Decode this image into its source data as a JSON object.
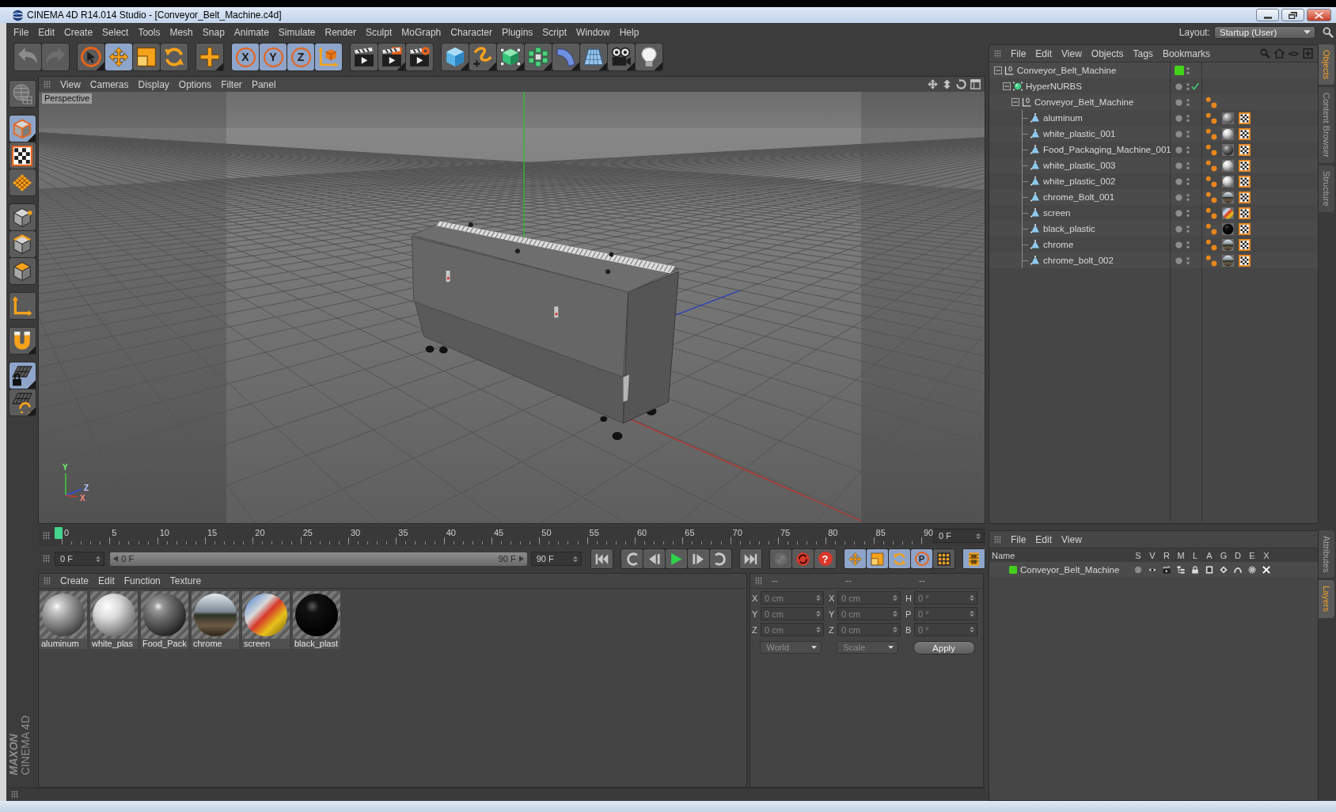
{
  "window": {
    "title": "CINEMA 4D R14.014 Studio - [Conveyor_Belt_Machine.c4d]"
  },
  "menu_bar": [
    "File",
    "Edit",
    "Create",
    "Select",
    "Tools",
    "Mesh",
    "Snap",
    "Animate",
    "Simulate",
    "Render",
    "Sculpt",
    "MoGraph",
    "Character",
    "Plugins",
    "Script",
    "Window",
    "Help"
  ],
  "layout": {
    "label": "Layout:",
    "value": "Startup (User)"
  },
  "toolbar": [
    [
      {
        "kind": "undo",
        "selected": false,
        "disabled": false,
        "menu": false
      },
      {
        "kind": "redo",
        "selected": false,
        "disabled": true,
        "menu": false
      }
    ],
    [
      {
        "kind": "select",
        "selected": false,
        "menu": true
      },
      {
        "kind": "move",
        "selected": true,
        "menu": false
      },
      {
        "kind": "scale",
        "selected": false,
        "menu": false
      },
      {
        "kind": "rotate",
        "selected": false,
        "menu": false
      }
    ],
    [
      {
        "kind": "plus",
        "selected": false,
        "menu": true
      }
    ],
    [
      {
        "kind": "axis",
        "label": "X",
        "selected": true,
        "menu": false
      },
      {
        "kind": "axis",
        "label": "Y",
        "selected": true,
        "menu": false
      },
      {
        "kind": "axis",
        "label": "Z",
        "selected": true,
        "menu": false
      },
      {
        "kind": "coords",
        "selected": true,
        "menu": false
      }
    ],
    [
      {
        "kind": "render-view",
        "selected": false,
        "menu": false
      },
      {
        "kind": "render-picture",
        "selected": false,
        "menu": true
      },
      {
        "kind": "render-settings",
        "selected": false,
        "menu": false
      }
    ],
    [
      {
        "kind": "cube",
        "selected": false,
        "menu": true
      },
      {
        "kind": "spline",
        "selected": false,
        "menu": true
      },
      {
        "kind": "nurbs",
        "selected": false,
        "menu": true
      },
      {
        "kind": "array",
        "selected": false,
        "menu": true
      },
      {
        "kind": "deformer",
        "selected": false,
        "menu": true
      },
      {
        "kind": "floor",
        "selected": false,
        "menu": true
      },
      {
        "kind": "camera",
        "selected": false,
        "menu": true
      },
      {
        "kind": "light",
        "selected": false,
        "menu": true
      }
    ]
  ],
  "tools": [
    [
      {
        "kind": "solo",
        "selected": false,
        "menu": false
      }
    ],
    [
      {
        "kind": "model",
        "selected": true,
        "menu": true
      },
      {
        "kind": "texture",
        "selected": false,
        "menu": false
      },
      {
        "kind": "workplane",
        "selected": false,
        "menu": false
      }
    ],
    [
      {
        "kind": "points",
        "selected": false,
        "menu": false
      },
      {
        "kind": "edges",
        "selected": false,
        "menu": false
      },
      {
        "kind": "polygons",
        "selected": false,
        "menu": false
      }
    ],
    [
      {
        "kind": "axis-mode",
        "selected": false,
        "menu": false
      }
    ],
    [
      {
        "kind": "snap",
        "selected": false,
        "menu": true
      }
    ],
    [
      {
        "kind": "lock-grid",
        "selected": true,
        "menu": true
      },
      {
        "kind": "planar",
        "selected": false,
        "menu": true
      }
    ]
  ],
  "logo": {
    "brand": "MAXON",
    "product": "CINEMA 4D"
  },
  "viewport": {
    "menu": [
      "View",
      "Cameras",
      "Display",
      "Options",
      "Filter",
      "Panel"
    ],
    "label": "Perspective",
    "gizmo_labels": [
      "Y",
      "Z",
      "X"
    ]
  },
  "timeline": {
    "ticks": [
      "0",
      "5",
      "10",
      "15",
      "20",
      "25",
      "30",
      "35",
      "40",
      "45",
      "50",
      "55",
      "60",
      "65",
      "70",
      "75",
      "80",
      "85",
      "90"
    ],
    "level": 0,
    "current": "0 F"
  },
  "transport": {
    "start": "0 F",
    "range": {
      "from": "0 F",
      "to": "90 F",
      "level": 1
    },
    "end": "90 F",
    "groups": [
      [
        {
          "kind": "go-start",
          "selected": false
        }
      ],
      [
        {
          "kind": "prev-key",
          "selected": false
        },
        {
          "kind": "prev-frame",
          "selected": false
        },
        {
          "kind": "play",
          "selected": false
        },
        {
          "kind": "next-frame",
          "selected": false
        },
        {
          "kind": "next-key",
          "selected": false
        }
      ],
      [
        {
          "kind": "go-end",
          "selected": false
        }
      ],
      [
        {
          "kind": "record",
          "selected": false,
          "disabled": true
        },
        {
          "kind": "autokey",
          "selected": false,
          "disabled": false
        },
        {
          "kind": "label",
          "label": "?",
          "selected": false,
          "disabled": false
        }
      ],
      [
        {
          "kind": "key-move",
          "selected": true
        },
        {
          "kind": "key-scale",
          "selected": true
        },
        {
          "kind": "key-rotate",
          "selected": true
        },
        {
          "kind": "ring",
          "label": "P",
          "selected": true
        },
        {
          "kind": "key-dots",
          "selected": false
        }
      ],
      [
        {
          "kind": "timeline",
          "selected": true
        }
      ]
    ]
  },
  "materials": {
    "menu": [
      "Create",
      "Edit",
      "Function",
      "Texture"
    ],
    "items": [
      {
        "name": "aluminum",
        "kind": "grey"
      },
      {
        "name": "white_plas",
        "kind": "white"
      },
      {
        "name": "Food_Pack",
        "kind": "dark"
      },
      {
        "name": "chrome",
        "kind": "chrome"
      },
      {
        "name": "screen",
        "kind": "screen"
      },
      {
        "name": "black_plast",
        "kind": "black"
      }
    ]
  },
  "coordinates": {
    "headers": [
      "--",
      "--",
      "--"
    ],
    "fields_disabled": true,
    "rows": [
      [
        {
          "axis": "X",
          "value": "0 cm"
        },
        {
          "axis": "X",
          "value": "0 cm"
        },
        {
          "axis": "H",
          "value": "0 °"
        }
      ],
      [
        {
          "axis": "Y",
          "value": "0 cm"
        },
        {
          "axis": "Y",
          "value": "0 cm"
        },
        {
          "axis": "P",
          "value": "0 °"
        }
      ],
      [
        {
          "axis": "Z",
          "value": "0 cm"
        },
        {
          "axis": "Z",
          "value": "0 cm"
        },
        {
          "axis": "B",
          "value": "0 °"
        }
      ]
    ],
    "dropdowns": [
      {
        "value": "World",
        "disabled": true
      },
      {
        "value": "Scale",
        "disabled": true
      }
    ],
    "apply": "Apply"
  },
  "objects": {
    "menu": [
      "File",
      "Edit",
      "View",
      "Objects",
      "Tags",
      "Bookmarks"
    ],
    "tree": [
      {
        "name": "Conveyor_Belt_Machine",
        "kind": "null",
        "color": "#44d11c",
        "expanded": true,
        "children": [
          {
            "name": "HyperNURBS",
            "kind": "hypernurbs",
            "enabled": true,
            "expanded": true,
            "children": [
              {
                "name": "Conveyor_Belt_Machine",
                "kind": "null",
                "expanded": true,
                "tags": [
                  {
                    "kind": "phong"
                  }
                ],
                "children": [
                  {
                    "name": "aluminum",
                    "kind": "polygon",
                    "tags": [
                      {
                        "kind": "phong"
                      },
                      {
                        "kind": "material-grey"
                      },
                      {
                        "kind": "uvw"
                      }
                    ]
                  },
                  {
                    "name": "white_plastic_001",
                    "kind": "polygon",
                    "tags": [
                      {
                        "kind": "phong"
                      },
                      {
                        "kind": "material-white"
                      },
                      {
                        "kind": "uvw"
                      }
                    ]
                  },
                  {
                    "name": "Food_Packaging_Machine_001",
                    "kind": "polygon",
                    "tags": [
                      {
                        "kind": "phong"
                      },
                      {
                        "kind": "material-dark"
                      },
                      {
                        "kind": "uvw"
                      }
                    ]
                  },
                  {
                    "name": "white_plastic_003",
                    "kind": "polygon",
                    "tags": [
                      {
                        "kind": "phong"
                      },
                      {
                        "kind": "material-white"
                      },
                      {
                        "kind": "uvw"
                      }
                    ]
                  },
                  {
                    "name": "white_plastic_002",
                    "kind": "polygon",
                    "tags": [
                      {
                        "kind": "phong"
                      },
                      {
                        "kind": "material-white"
                      },
                      {
                        "kind": "uvw"
                      }
                    ]
                  },
                  {
                    "name": "chrome_Bolt_001",
                    "kind": "polygon",
                    "tags": [
                      {
                        "kind": "phong"
                      },
                      {
                        "kind": "material-chrome"
                      },
                      {
                        "kind": "uvw"
                      }
                    ]
                  },
                  {
                    "name": "screen",
                    "kind": "polygon",
                    "tags": [
                      {
                        "kind": "phong"
                      },
                      {
                        "kind": "material-screen"
                      },
                      {
                        "kind": "uvw"
                      }
                    ]
                  },
                  {
                    "name": "black_plastic",
                    "kind": "polygon",
                    "tags": [
                      {
                        "kind": "phong"
                      },
                      {
                        "kind": "material-black"
                      },
                      {
                        "kind": "uvw"
                      }
                    ]
                  },
                  {
                    "name": "chrome",
                    "kind": "polygon",
                    "tags": [
                      {
                        "kind": "phong"
                      },
                      {
                        "kind": "material-chrome"
                      },
                      {
                        "kind": "uvw"
                      }
                    ]
                  },
                  {
                    "name": "chrome_bolt_002",
                    "kind": "polygon",
                    "tags": [
                      {
                        "kind": "phong"
                      },
                      {
                        "kind": "material-chrome"
                      },
                      {
                        "kind": "uvw"
                      }
                    ]
                  }
                ]
              }
            ]
          }
        ]
      }
    ]
  },
  "layers": {
    "menu": [
      "File",
      "Edit",
      "View"
    ],
    "columns": [
      "Name",
      "S",
      "V",
      "R",
      "M",
      "L",
      "A",
      "G",
      "D",
      "E",
      "X"
    ],
    "rows": [
      {
        "name": "Conveyor_Belt_Machine",
        "color": "#44d11c"
      }
    ]
  },
  "side_tabs": {
    "top": [
      {
        "label": "Objects",
        "selected": true
      },
      {
        "label": "Content Browser",
        "selected": false
      },
      {
        "label": "Structure",
        "selected": false
      }
    ],
    "bottom": [
      {
        "label": "Attributes",
        "selected": false
      },
      {
        "label": "Layers",
        "selected": true
      }
    ]
  }
}
